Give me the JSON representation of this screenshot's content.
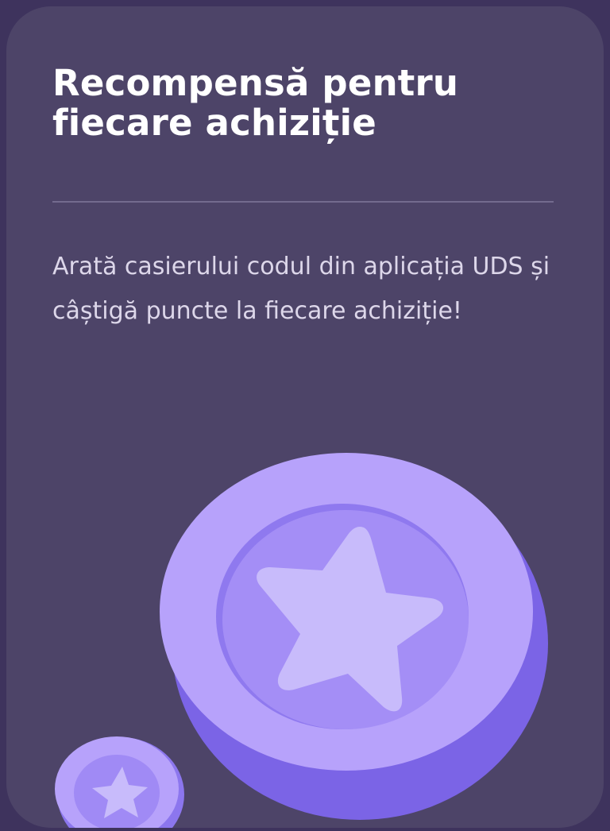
{
  "card": {
    "title": "Recompensă pentru fiecare achiziție",
    "description": "Arată casierului codul din aplicația UDS și câștigă puncte la fiecare achiziție!"
  },
  "illustration": {
    "big_coin_icon": "star-coin-icon",
    "small_coin_icon": "star-coin-icon"
  },
  "colors": {
    "page_background": "#3e335d",
    "card_background": "#4d4468",
    "coin_light": "#b7a2fb",
    "coin_dark": "#7b64e6",
    "star": "#c8bbfb"
  }
}
